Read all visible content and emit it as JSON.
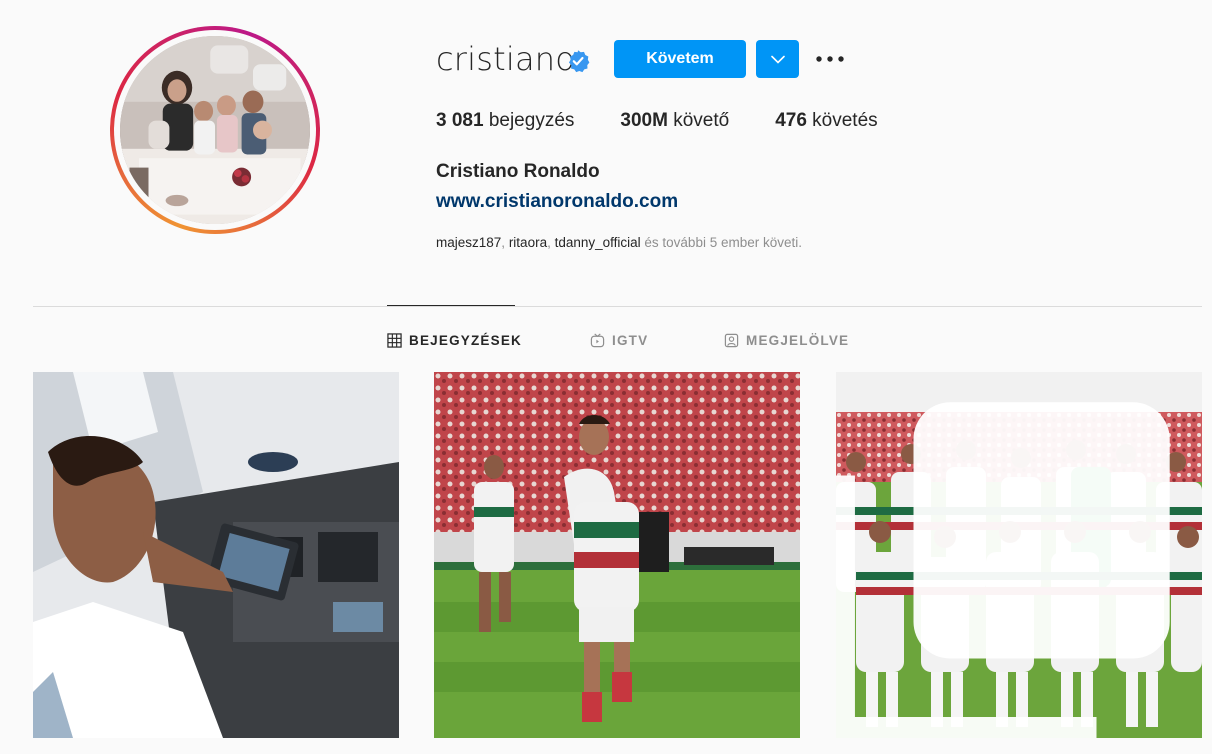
{
  "profile": {
    "username": "cristiano",
    "full_name": "Cristiano Ronaldo",
    "website": "www.cristianoronaldo.com",
    "verified": true
  },
  "actions": {
    "follow_label": "Követem",
    "dropdown_icon": "chevron-down-icon",
    "more_icon": "more-options-icon"
  },
  "stats": {
    "posts_count": "3 081",
    "posts_label": " bejegyzés",
    "followers_count": "300M",
    "followers_label": " követő",
    "following_count": "476",
    "following_label": " követés"
  },
  "followed_by": {
    "names": [
      "majesz187",
      "ritaora",
      "tdanny_official"
    ],
    "sep1": ", ",
    "sep2": ", ",
    "suffix": " és további 5 ember követi."
  },
  "tabs": [
    {
      "label": "BEJEGYZÉSEK",
      "icon": "grid-icon",
      "active": true
    },
    {
      "label": "IGTV",
      "icon": "igtv-icon",
      "active": false
    },
    {
      "label": "MEGJELÖLVE",
      "icon": "tagged-icon",
      "active": false
    }
  ],
  "colors": {
    "accent": "#0095f6",
    "link": "#00376b",
    "text": "#262626",
    "muted": "#8e8e8e",
    "background": "#fafafa"
  }
}
